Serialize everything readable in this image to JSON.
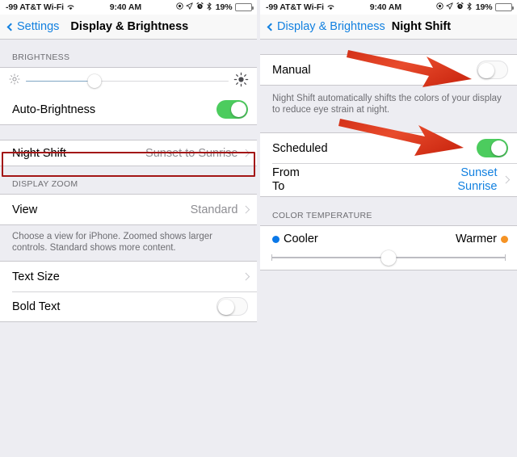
{
  "status_bar": {
    "carrier": "-99 AT&T Wi-Fi",
    "wifi_icon": "wifi-icon",
    "time": "9:40 AM",
    "right_icons": [
      "do-not-disturb-icon",
      "location-arrow-icon",
      "alarm-clock-icon",
      "bluetooth-icon"
    ],
    "battery_percent": "19%",
    "battery_level": 19,
    "battery_color": "#ef3124"
  },
  "left_screen": {
    "nav": {
      "back_label": "Settings",
      "title": "Display & Brightness"
    },
    "brightness": {
      "header": "BRIGHTNESS",
      "slider_value": 34,
      "low_icon": "sun-dim-icon",
      "high_icon": "sun-bright-icon",
      "fill_color": "#7fa5c4",
      "auto_brightness_label": "Auto-Brightness",
      "auto_brightness_state": "on"
    },
    "night_shift": {
      "label": "Night Shift",
      "value": "Sunset to Sunrise",
      "chevron_icon": "chevron-right-icon",
      "highlighted": true,
      "highlight_color": "#a31616"
    },
    "display_zoom": {
      "header": "DISPLAY ZOOM",
      "view_label": "View",
      "view_value": "Standard",
      "footnote": "Choose a view for iPhone. Zoomed shows larger controls. Standard shows more content."
    },
    "text": {
      "text_size_label": "Text Size",
      "bold_text_label": "Bold Text",
      "bold_text_state": "off"
    }
  },
  "right_screen": {
    "nav": {
      "back_label": "Display & Brightness",
      "title": "Night Shift"
    },
    "manual": {
      "label": "Manual",
      "state": "off",
      "footnote": "Night Shift automatically shifts the colors of your display to reduce eye strain at night."
    },
    "scheduled": {
      "label": "Scheduled",
      "state": "on",
      "from_label": "From",
      "to_label": "To",
      "from_value": "Sunset",
      "to_value": "Sunrise",
      "chevron_icon": "chevron-right-icon"
    },
    "color_temperature": {
      "header": "COLOR TEMPERATURE",
      "cooler_label": "Cooler",
      "warmer_label": "Warmer",
      "cooler_dot_color": "#0a78e8",
      "warmer_dot_color": "#f59324",
      "slider_value": 50
    }
  },
  "annotations": {
    "arrow_color": "#e03a22",
    "arrows": [
      "arrow-pointing-to-manual-toggle",
      "arrow-pointing-to-scheduled-toggle"
    ]
  }
}
